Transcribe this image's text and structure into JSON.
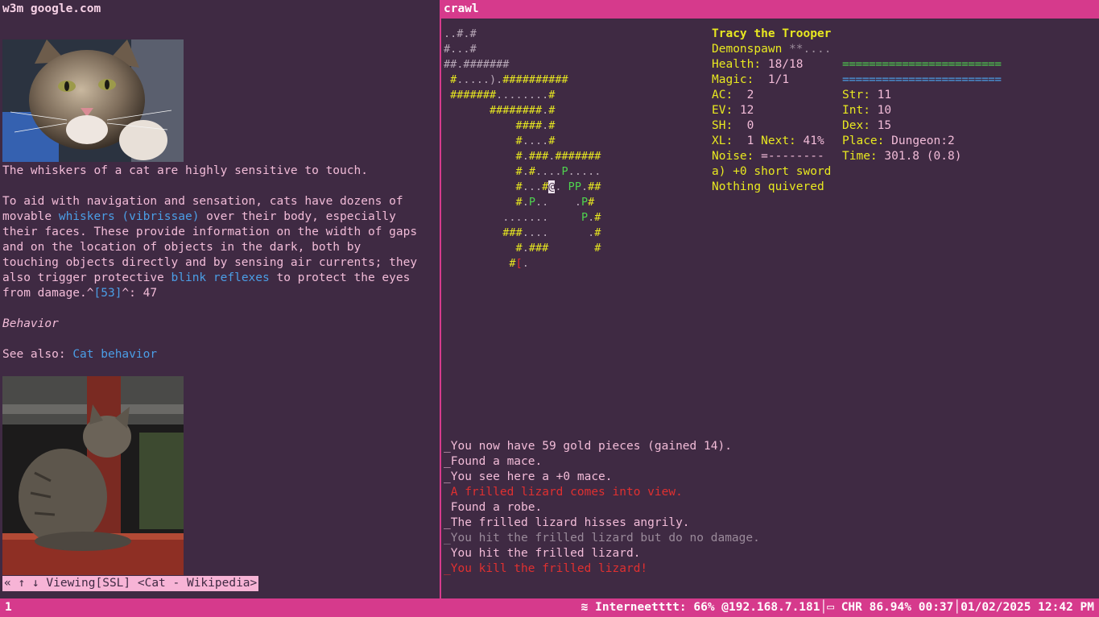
{
  "left_pane": {
    "title": "w3m google.com",
    "cat_images": [
      "cat-photo-grey-tabby",
      "cat-photo-sitting-tabby"
    ],
    "p1": "The whiskers of a cat are highly sensitive to touch.",
    "p2_lines": [
      "To aid with navigation and sensation, cats have dozens of",
      [
        "movable ",
        "whiskers (vibrissae)",
        " over their body, especially"
      ],
      "their faces. These provide information on the width of gaps",
      "and on the location of objects in the dark, both by",
      "touching objects directly and by sensing air currents; they",
      [
        "also trigger protective ",
        "blink reflexes",
        " to protect the eyes"
      ],
      [
        "from damage.^",
        "[53]",
        "^: 47"
      ]
    ],
    "heading": "Behavior",
    "see_also_prefix": "See also: ",
    "see_also_link": "Cat behavior",
    "status": "« ↑ ↓ Viewing[SSL] <Cat - Wikipedia>"
  },
  "right_pane": {
    "title": "crawl",
    "map_rows": [
      "..#.#",
      "#...#",
      "##.#######",
      " #.....).##########",
      " #######........#",
      "       ########.#",
      "           ####.#",
      "           #....#",
      "           #.###.#######",
      "           #.#....P.....",
      "           #...#@. PP.##",
      "           #.P..    .P#",
      "         .......     P.#",
      "         ###....      .#",
      "           #.###       #",
      "          #[."
    ],
    "char_name": "Tracy the Trooper",
    "species": "Demonspawn",
    "species_suffix": "**....",
    "health_label": "Health:",
    "health": "18/18",
    "magic_label": "Magic:",
    "magic": "1/1",
    "ac_label": "AC:",
    "ac": "2",
    "ev_label": "EV:",
    "ev": "12",
    "sh_label": "SH:",
    "sh": "0",
    "xl_label": "XL:",
    "xl": "1",
    "next_label": "Next:",
    "next": "41%",
    "noise_label": "Noise:",
    "noise": "=--------",
    "str_label": "Str:",
    "str": "11",
    "int_label": "Int:",
    "int": "10",
    "dex_label": "Dex:",
    "dex": "15",
    "place_label": "Place:",
    "place": "Dungeon:2",
    "time_label": "Time:",
    "time": "301.8 (0.8)",
    "health_bar": "========================",
    "magic_bar": "========================",
    "weapon": "a) +0 short sword",
    "quiver": "Nothing quivered",
    "messages": [
      {
        "text": "_You now have 59 gold pieces (gained 14).",
        "color": "#f2bcd8"
      },
      {
        "text": "_Found a mace.",
        "color": "#f2bcd8"
      },
      {
        "text": "_You see here a +0 mace.",
        "color": "#f2bcd8"
      },
      {
        "text": " A frilled lizard comes into view.",
        "color": "#e03030"
      },
      {
        "text": " Found a robe.",
        "color": "#f2bcd8"
      },
      {
        "text": "_The frilled lizard hisses angrily.",
        "color": "#f2bcd8"
      },
      {
        "text": "_You hit the frilled lizard but do no damage.",
        "color": "#9a8a9a"
      },
      {
        "text": " You hit the frilled lizard.",
        "color": "#f2bcd8"
      },
      {
        "text": "_You kill the frilled lizard!",
        "color": "#e03030"
      }
    ]
  },
  "bottom_bar": {
    "workspace": "1",
    "network": "Interneetttt: 66% @192.168.7.181",
    "battery": "CHR 86.94% 00:37",
    "datetime": "01/02/2025 12:42 PM"
  },
  "colors": {
    "background": "#3f2a43",
    "accent": "#d63a8c",
    "text": "#f2bcd8",
    "link": "#4b9ee6",
    "stat_label": "#e8e820",
    "good": "#4fd44f",
    "danger": "#e03030"
  }
}
